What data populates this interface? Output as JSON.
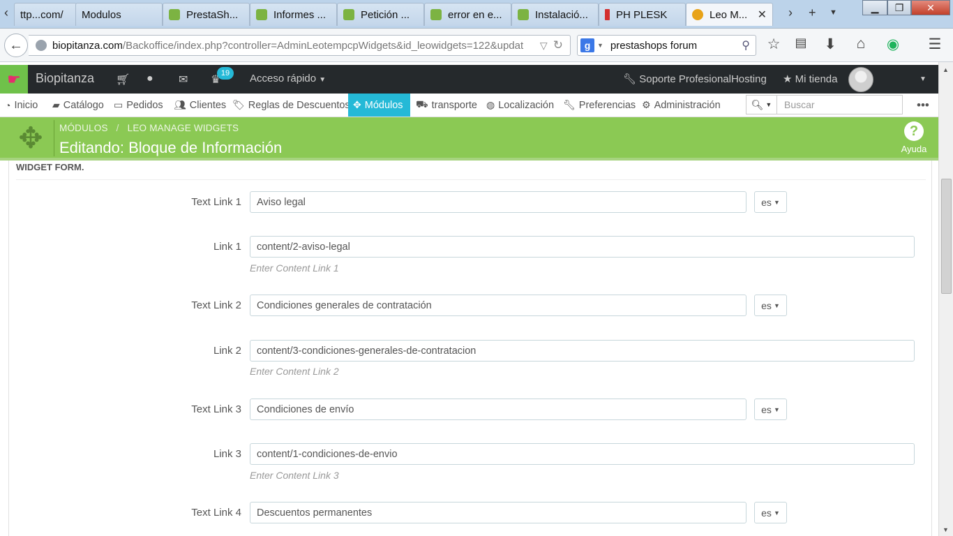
{
  "browser": {
    "tabs": [
      {
        "label": "ttp...com/",
        "icon": "none",
        "active": false
      },
      {
        "label": "Modulos",
        "icon": "none",
        "active": false
      },
      {
        "label": "PrestaSh...",
        "icon": "prestashop-icon",
        "active": false
      },
      {
        "label": "Informes ...",
        "icon": "prestashop-icon",
        "active": false
      },
      {
        "label": "Petición ...",
        "icon": "prestashop-icon",
        "active": false
      },
      {
        "label": "error en e...",
        "icon": "prestashop-icon",
        "active": false
      },
      {
        "label": "Instalació...",
        "icon": "prestashop-icon",
        "active": false
      },
      {
        "label": "PH PLESK",
        "icon": "plesk-icon",
        "active": false
      },
      {
        "label": "Leo M...",
        "icon": "leo-icon",
        "active": true
      }
    ],
    "tab_close": "✕",
    "new_tab": "+",
    "url_domain": "biopitanza.com",
    "url_path": "/Backoffice/index.php?controller=AdminLeotempcpWidgets&id_leowidgets=122&updat",
    "search_engine_letter": "g",
    "search_query": "prestashops forum"
  },
  "ps": {
    "shop_name": "Biopitanza",
    "notification_count": "19",
    "quick_access": "Acceso rápido",
    "support_link": "Soporte ProfesionalHosting",
    "my_shop": "Mi tienda",
    "menu": [
      {
        "label": "Inicio",
        "icon": "dashboard-icon"
      },
      {
        "label": "Catálogo",
        "icon": "book-icon"
      },
      {
        "label": "Pedidos",
        "icon": "credit-card-icon"
      },
      {
        "label": "Clientes",
        "icon": "users-icon"
      },
      {
        "label": "Reglas de Descuentos",
        "icon": "tags-icon"
      },
      {
        "label": "Módulos",
        "icon": "puzzle-icon"
      },
      {
        "label": "transporte",
        "icon": "truck-icon"
      },
      {
        "label": "Localización",
        "icon": "globe-icon"
      },
      {
        "label": "Preferencias",
        "icon": "wrench-icon"
      },
      {
        "label": "Administración",
        "icon": "cogs-icon"
      }
    ],
    "search_placeholder": "Buscar",
    "breadcrumb": [
      "MÓDULOS",
      "LEO MANAGE WIDGETS"
    ],
    "breadcrumb_sep": "/",
    "page_title": "Editando: Bloque de Información",
    "help_label": "Ayuda"
  },
  "form": {
    "heading": "WIDGET FORM.",
    "lang_code": "es",
    "fields": [
      {
        "label": "Text Link 1",
        "value": "Aviso legal",
        "type": "text"
      },
      {
        "label": "Link 1",
        "value": "content/2-aviso-legal",
        "type": "link",
        "hint": "Enter Content Link 1"
      },
      {
        "label": "Text Link 2",
        "value": "Condiciones generales de contratación",
        "type": "text"
      },
      {
        "label": "Link 2",
        "value": "content/3-condiciones-generales-de-contratacion",
        "type": "link",
        "hint": "Enter Content Link 2"
      },
      {
        "label": "Text Link 3",
        "value": "Condiciones de envío",
        "type": "text"
      },
      {
        "label": "Link 3",
        "value": "content/1-condiciones-de-envio",
        "type": "link",
        "hint": "Enter Content Link 3"
      },
      {
        "label": "Text Link 4",
        "value": "Descuentos permanentes",
        "type": "text"
      }
    ]
  }
}
